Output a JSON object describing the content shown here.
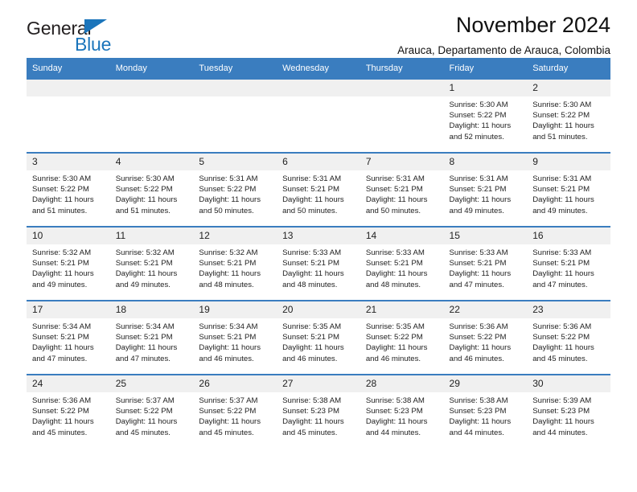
{
  "brand": {
    "name_part1": "General",
    "name_part2": "Blue",
    "accent_color": "#1b75bb"
  },
  "header": {
    "title": "November 2024",
    "subtitle": "Arauca, Departamento de Arauca, Colombia"
  },
  "theme": {
    "header_row_bg": "#3a7dbf",
    "daynum_band_bg": "#f0f0f0",
    "grid_line": "#3a7dbf"
  },
  "weekday_headers": [
    "Sunday",
    "Monday",
    "Tuesday",
    "Wednesday",
    "Thursday",
    "Friday",
    "Saturday"
  ],
  "weeks": [
    [
      {
        "day": "",
        "sunrise": "",
        "sunset": "",
        "daylight": "",
        "empty": true
      },
      {
        "day": "",
        "sunrise": "",
        "sunset": "",
        "daylight": "",
        "empty": true
      },
      {
        "day": "",
        "sunrise": "",
        "sunset": "",
        "daylight": "",
        "empty": true
      },
      {
        "day": "",
        "sunrise": "",
        "sunset": "",
        "daylight": "",
        "empty": true
      },
      {
        "day": "",
        "sunrise": "",
        "sunset": "",
        "daylight": "",
        "empty": true
      },
      {
        "day": "1",
        "sunrise": "Sunrise: 5:30 AM",
        "sunset": "Sunset: 5:22 PM",
        "daylight": "Daylight: 11 hours and 52 minutes.",
        "empty": false
      },
      {
        "day": "2",
        "sunrise": "Sunrise: 5:30 AM",
        "sunset": "Sunset: 5:22 PM",
        "daylight": "Daylight: 11 hours and 51 minutes.",
        "empty": false
      }
    ],
    [
      {
        "day": "3",
        "sunrise": "Sunrise: 5:30 AM",
        "sunset": "Sunset: 5:22 PM",
        "daylight": "Daylight: 11 hours and 51 minutes.",
        "empty": false
      },
      {
        "day": "4",
        "sunrise": "Sunrise: 5:30 AM",
        "sunset": "Sunset: 5:22 PM",
        "daylight": "Daylight: 11 hours and 51 minutes.",
        "empty": false
      },
      {
        "day": "5",
        "sunrise": "Sunrise: 5:31 AM",
        "sunset": "Sunset: 5:22 PM",
        "daylight": "Daylight: 11 hours and 50 minutes.",
        "empty": false
      },
      {
        "day": "6",
        "sunrise": "Sunrise: 5:31 AM",
        "sunset": "Sunset: 5:21 PM",
        "daylight": "Daylight: 11 hours and 50 minutes.",
        "empty": false
      },
      {
        "day": "7",
        "sunrise": "Sunrise: 5:31 AM",
        "sunset": "Sunset: 5:21 PM",
        "daylight": "Daylight: 11 hours and 50 minutes.",
        "empty": false
      },
      {
        "day": "8",
        "sunrise": "Sunrise: 5:31 AM",
        "sunset": "Sunset: 5:21 PM",
        "daylight": "Daylight: 11 hours and 49 minutes.",
        "empty": false
      },
      {
        "day": "9",
        "sunrise": "Sunrise: 5:31 AM",
        "sunset": "Sunset: 5:21 PM",
        "daylight": "Daylight: 11 hours and 49 minutes.",
        "empty": false
      }
    ],
    [
      {
        "day": "10",
        "sunrise": "Sunrise: 5:32 AM",
        "sunset": "Sunset: 5:21 PM",
        "daylight": "Daylight: 11 hours and 49 minutes.",
        "empty": false
      },
      {
        "day": "11",
        "sunrise": "Sunrise: 5:32 AM",
        "sunset": "Sunset: 5:21 PM",
        "daylight": "Daylight: 11 hours and 49 minutes.",
        "empty": false
      },
      {
        "day": "12",
        "sunrise": "Sunrise: 5:32 AM",
        "sunset": "Sunset: 5:21 PM",
        "daylight": "Daylight: 11 hours and 48 minutes.",
        "empty": false
      },
      {
        "day": "13",
        "sunrise": "Sunrise: 5:33 AM",
        "sunset": "Sunset: 5:21 PM",
        "daylight": "Daylight: 11 hours and 48 minutes.",
        "empty": false
      },
      {
        "day": "14",
        "sunrise": "Sunrise: 5:33 AM",
        "sunset": "Sunset: 5:21 PM",
        "daylight": "Daylight: 11 hours and 48 minutes.",
        "empty": false
      },
      {
        "day": "15",
        "sunrise": "Sunrise: 5:33 AM",
        "sunset": "Sunset: 5:21 PM",
        "daylight": "Daylight: 11 hours and 47 minutes.",
        "empty": false
      },
      {
        "day": "16",
        "sunrise": "Sunrise: 5:33 AM",
        "sunset": "Sunset: 5:21 PM",
        "daylight": "Daylight: 11 hours and 47 minutes.",
        "empty": false
      }
    ],
    [
      {
        "day": "17",
        "sunrise": "Sunrise: 5:34 AM",
        "sunset": "Sunset: 5:21 PM",
        "daylight": "Daylight: 11 hours and 47 minutes.",
        "empty": false
      },
      {
        "day": "18",
        "sunrise": "Sunrise: 5:34 AM",
        "sunset": "Sunset: 5:21 PM",
        "daylight": "Daylight: 11 hours and 47 minutes.",
        "empty": false
      },
      {
        "day": "19",
        "sunrise": "Sunrise: 5:34 AM",
        "sunset": "Sunset: 5:21 PM",
        "daylight": "Daylight: 11 hours and 46 minutes.",
        "empty": false
      },
      {
        "day": "20",
        "sunrise": "Sunrise: 5:35 AM",
        "sunset": "Sunset: 5:21 PM",
        "daylight": "Daylight: 11 hours and 46 minutes.",
        "empty": false
      },
      {
        "day": "21",
        "sunrise": "Sunrise: 5:35 AM",
        "sunset": "Sunset: 5:22 PM",
        "daylight": "Daylight: 11 hours and 46 minutes.",
        "empty": false
      },
      {
        "day": "22",
        "sunrise": "Sunrise: 5:36 AM",
        "sunset": "Sunset: 5:22 PM",
        "daylight": "Daylight: 11 hours and 46 minutes.",
        "empty": false
      },
      {
        "day": "23",
        "sunrise": "Sunrise: 5:36 AM",
        "sunset": "Sunset: 5:22 PM",
        "daylight": "Daylight: 11 hours and 45 minutes.",
        "empty": false
      }
    ],
    [
      {
        "day": "24",
        "sunrise": "Sunrise: 5:36 AM",
        "sunset": "Sunset: 5:22 PM",
        "daylight": "Daylight: 11 hours and 45 minutes.",
        "empty": false
      },
      {
        "day": "25",
        "sunrise": "Sunrise: 5:37 AM",
        "sunset": "Sunset: 5:22 PM",
        "daylight": "Daylight: 11 hours and 45 minutes.",
        "empty": false
      },
      {
        "day": "26",
        "sunrise": "Sunrise: 5:37 AM",
        "sunset": "Sunset: 5:22 PM",
        "daylight": "Daylight: 11 hours and 45 minutes.",
        "empty": false
      },
      {
        "day": "27",
        "sunrise": "Sunrise: 5:38 AM",
        "sunset": "Sunset: 5:23 PM",
        "daylight": "Daylight: 11 hours and 45 minutes.",
        "empty": false
      },
      {
        "day": "28",
        "sunrise": "Sunrise: 5:38 AM",
        "sunset": "Sunset: 5:23 PM",
        "daylight": "Daylight: 11 hours and 44 minutes.",
        "empty": false
      },
      {
        "day": "29",
        "sunrise": "Sunrise: 5:38 AM",
        "sunset": "Sunset: 5:23 PM",
        "daylight": "Daylight: 11 hours and 44 minutes.",
        "empty": false
      },
      {
        "day": "30",
        "sunrise": "Sunrise: 5:39 AM",
        "sunset": "Sunset: 5:23 PM",
        "daylight": "Daylight: 11 hours and 44 minutes.",
        "empty": false
      }
    ]
  ]
}
